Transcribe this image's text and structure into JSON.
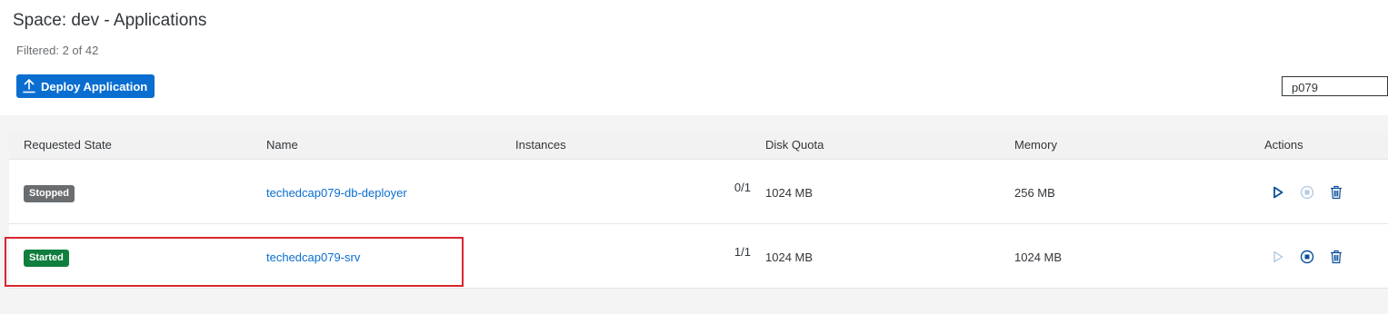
{
  "header": {
    "title": "Space: dev - Applications",
    "filter_status": "Filtered: 2 of 42",
    "deploy_button_label": "Deploy Application",
    "search_value": "p079"
  },
  "table": {
    "columns": [
      "Requested State",
      "Name",
      "Instances",
      "Disk Quota",
      "Memory",
      "Actions"
    ],
    "rows": [
      {
        "state": "Stopped",
        "name": "techedcap079-db-deployer",
        "instances": "0/1",
        "disk_quota": "1024 MB",
        "memory": "256 MB",
        "start_enabled": true,
        "stop_enabled": false
      },
      {
        "state": "Started",
        "name": "techedcap079-srv",
        "instances": "1/1",
        "disk_quota": "1024 MB",
        "memory": "1024 MB",
        "start_enabled": false,
        "stop_enabled": true
      }
    ]
  },
  "icons": {
    "deploy": "upload-icon",
    "start": "play-icon",
    "stop": "stop-icon",
    "delete": "trash-icon"
  },
  "colors": {
    "accent": "#0a6ed1",
    "stopped_badge": "#6a6d70",
    "started_badge": "#107e3e",
    "highlight": "#d9262e"
  }
}
